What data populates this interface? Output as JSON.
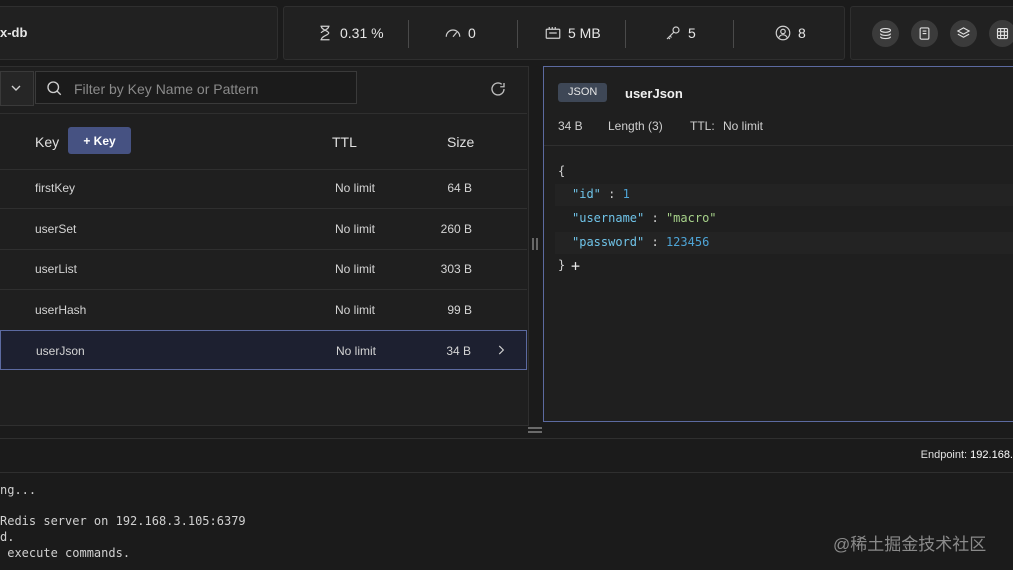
{
  "header": {
    "db_name": "x-db",
    "stats": {
      "cpu": "0.31 %",
      "ops": "0",
      "memory": "5 MB",
      "keys": "5",
      "clients": "8"
    }
  },
  "keylist": {
    "filter_placeholder": "Filter by Key Name or Pattern",
    "columns": {
      "key": "Key",
      "ttl": "TTL",
      "size": "Size"
    },
    "add_key_label": "+ Key",
    "rows": [
      {
        "name": "firstKey",
        "ttl": "No limit",
        "size": "64 B"
      },
      {
        "name": "userSet",
        "ttl": "No limit",
        "size": "260 B"
      },
      {
        "name": "userList",
        "ttl": "No limit",
        "size": "303 B"
      },
      {
        "name": "userHash",
        "ttl": "No limit",
        "size": "99 B"
      },
      {
        "name": "userJson",
        "ttl": "No limit",
        "size": "34 B"
      }
    ],
    "selected_index": 4
  },
  "details": {
    "type_badge": "JSON",
    "key_name": "userJson",
    "size": "34 B",
    "length": "Length (3)",
    "ttl_label": "TTL:",
    "ttl_value": "No limit",
    "json": {
      "open": "{",
      "close": "}",
      "add": "+",
      "entries": [
        {
          "key": "\"id\"",
          "sep": ":",
          "value": "1",
          "kind": "num"
        },
        {
          "key": "\"username\"",
          "sep": ":",
          "value": "\"macro\"",
          "kind": "str"
        },
        {
          "key": "\"password\"",
          "sep": ":",
          "value": "123456",
          "kind": "num"
        }
      ]
    }
  },
  "cli": {
    "endpoint_label": "Endpoint:",
    "endpoint_value": "192.168.",
    "lines": [
      "ng...",
      "",
      "Redis server on 192.168.3.105:6379",
      "d.",
      " execute commands."
    ]
  },
  "watermark": "@稀土掘金技术社区"
}
